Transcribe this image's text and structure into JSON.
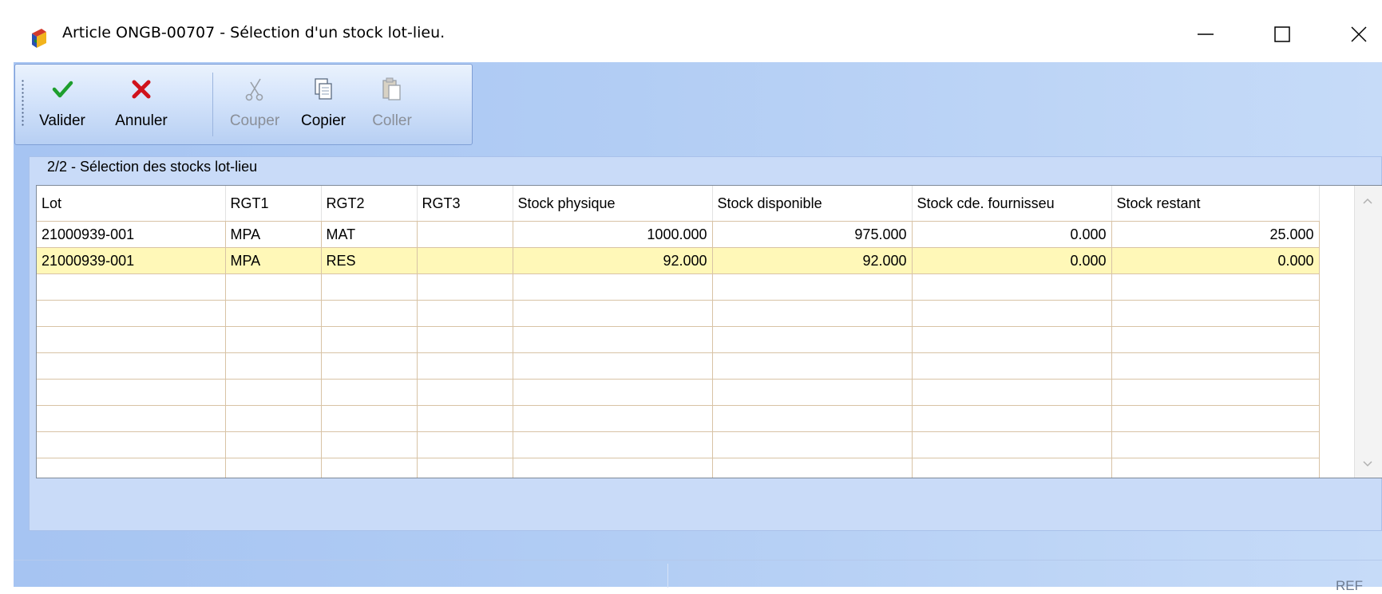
{
  "window": {
    "title": "Article ONGB-00707 - Sélection d'un stock lot-lieu.",
    "app_icon": "books-icon",
    "controls": [
      "minimize-icon",
      "maximize-icon",
      "close-icon"
    ]
  },
  "toolbar": {
    "valider": "Valider",
    "annuler": "Annuler",
    "couper": "Couper",
    "copier": "Copier",
    "coller": "Coller"
  },
  "panel": {
    "title": "2/2 - Sélection des stocks lot-lieu"
  },
  "grid": {
    "columns": [
      "Lot",
      "RGT1",
      "RGT2",
      "RGT3",
      "Stock physique",
      "Stock disponible",
      "Stock cde. fournisseu",
      "Stock restant"
    ],
    "rows": [
      [
        "21000939-001",
        "MPA",
        "MAT",
        "",
        "1000.000",
        "975.000",
        "0.000",
        "25.000"
      ],
      [
        "21000939-001",
        "MPA",
        "RES",
        "",
        "92.000",
        "92.000",
        "0.000",
        "0.000"
      ]
    ],
    "selected_row": 1
  },
  "status": {
    "ref": "REF"
  },
  "colors": {
    "selected_row": "#fff8b8",
    "valider_check": "#1e9e2e",
    "annuler_cross": "#d0121b",
    "gridline": "#d8c3a5"
  }
}
